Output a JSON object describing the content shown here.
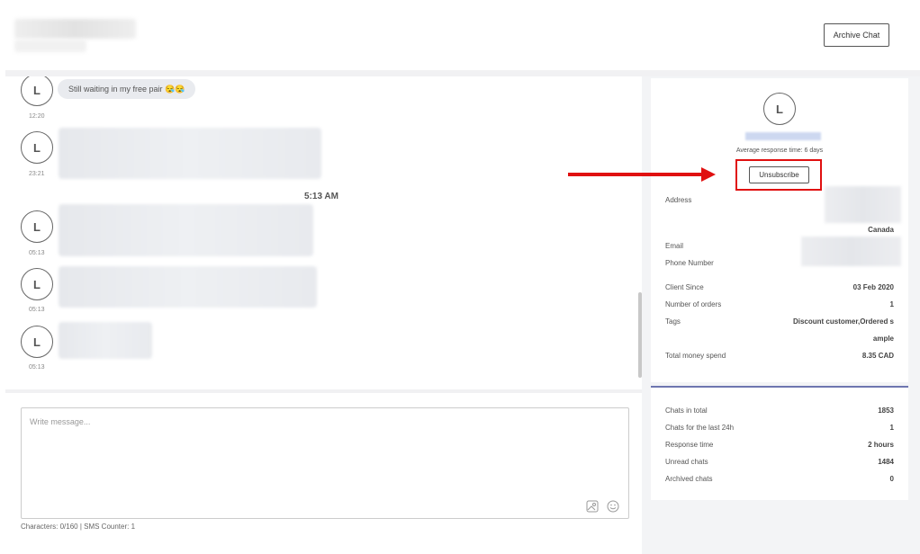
{
  "header": {
    "archive_label": "Archive Chat"
  },
  "chat": {
    "messages": [
      {
        "avatar": "L",
        "text": "Still waiting in my free pair 😪😪",
        "time": "12:20"
      },
      {
        "avatar": "L",
        "text": "",
        "time": "23:21"
      },
      {
        "avatar": "L",
        "text": "",
        "time": "05:13"
      },
      {
        "avatar": "L",
        "text": "",
        "time": "05:13"
      },
      {
        "avatar": "L",
        "text": "",
        "time": "05:13"
      }
    ],
    "day_separator": "5:13 AM"
  },
  "composer": {
    "placeholder": "Write message...",
    "counter": "Characters: 0/160 | SMS Counter: 1",
    "icons": [
      "image-icon",
      "emoji-icon"
    ]
  },
  "profile": {
    "avatar": "L",
    "avg_response": "Average response time: 6 days",
    "unsubscribe_label": "Unsubscribe",
    "address_label": "Address",
    "address_value": "Canada",
    "email_label": "Email",
    "phone_label": "Phone Number",
    "client_since_label": "Client Since",
    "client_since_value": "03 Feb 2020",
    "orders_label": "Number of orders",
    "orders_value": "1",
    "tags_label": "Tags",
    "tags_value_line1": "Discount customer,Ordered s",
    "tags_value_line2": "ample",
    "money_label": "Total money spend",
    "money_value": "8.35 CAD"
  },
  "stats": {
    "chats_total_label": "Chats in total",
    "chats_total_value": "1853",
    "chats_24h_label": "Chats for the last 24h",
    "chats_24h_value": "1",
    "response_time_label": "Response time",
    "response_time_value": "2 hours",
    "unread_label": "Unread chats",
    "unread_value": "1484",
    "archived_label": "Archived chats",
    "archived_value": "0"
  },
  "colors": {
    "highlight": "#e01010",
    "accent_line": "#6e76b0"
  }
}
